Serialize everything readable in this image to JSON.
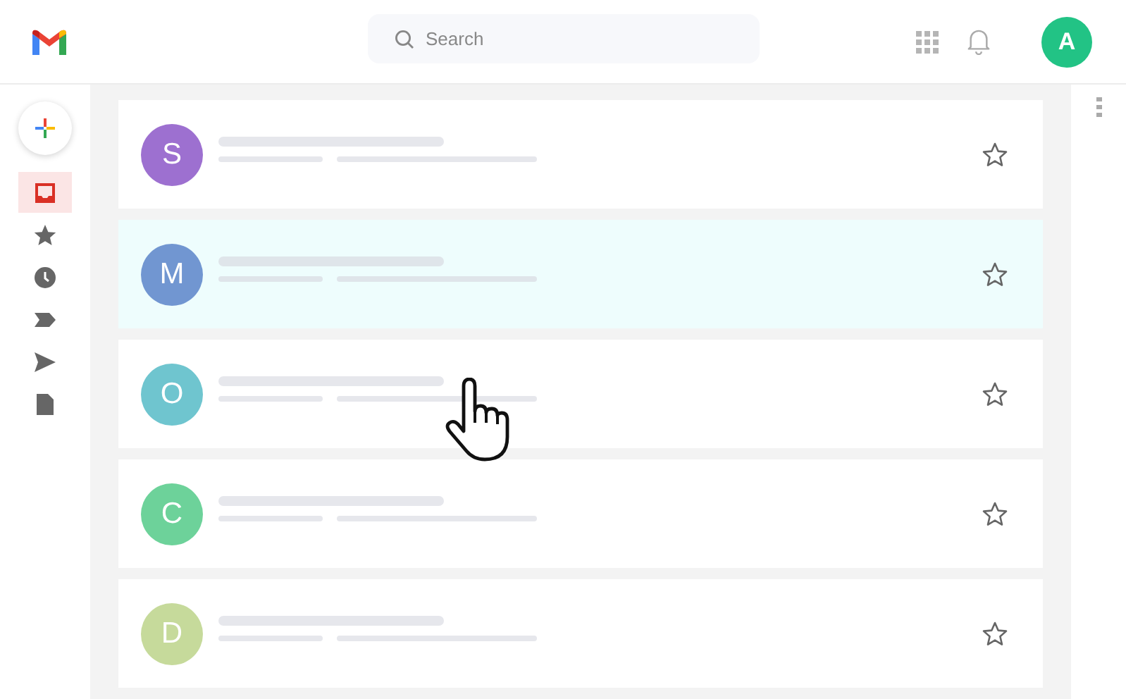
{
  "header": {
    "search": {
      "placeholder": "Search"
    },
    "account": {
      "initial": "A",
      "color": "#22c385"
    }
  },
  "sidebar": {
    "items": [
      {
        "kind": "compose"
      },
      {
        "kind": "inbox",
        "selected": true
      },
      {
        "kind": "starred",
        "selected": false
      },
      {
        "kind": "snoozed",
        "selected": false
      },
      {
        "kind": "important",
        "selected": false
      },
      {
        "kind": "sent",
        "selected": false
      },
      {
        "kind": "drafts",
        "selected": false
      }
    ]
  },
  "messages": [
    {
      "initial": "S",
      "color": "#9d70d0",
      "selected": false,
      "starred": false
    },
    {
      "initial": "M",
      "color": "#7196d1",
      "selected": true,
      "starred": false
    },
    {
      "initial": "O",
      "color": "#6fc5cf",
      "selected": false,
      "starred": false
    },
    {
      "initial": "C",
      "color": "#6dd29a",
      "selected": false,
      "starred": false
    },
    {
      "initial": "D",
      "color": "#c6da9b",
      "selected": false,
      "starred": false
    }
  ]
}
